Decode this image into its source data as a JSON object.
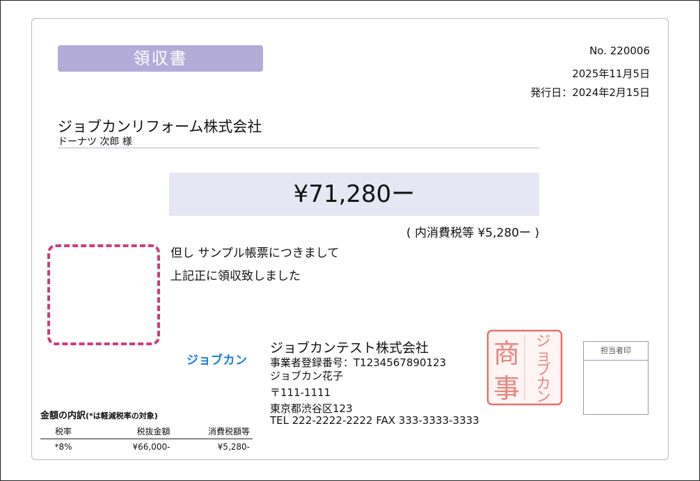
{
  "receipt": {
    "title": "領収書",
    "number": "No. 220006",
    "date": "2025年11月5日",
    "issue_date": "発行日：2024年2月15日"
  },
  "recipient": {
    "company": "ジョブカンリフォーム株式会社",
    "person": "ドーナツ 次郎 様"
  },
  "amount": {
    "total": "¥71,280ー",
    "tax_note": "( 内消費税等 ¥5,280ー )"
  },
  "memo": {
    "line1": "但し サンプル帳票につきまして",
    "line2": "上記正に領収致しました"
  },
  "issuer": {
    "logo_text": "ジョブカン",
    "company": "ジョブカンテスト株式会社",
    "registration": "事業者登録番号：T1234567890123",
    "person": "ジョブカン花子",
    "postal": "〒111-1111",
    "address": "東京都渋谷区123",
    "contact": "TEL 222-2222-2222 FAX 333-3333-3333"
  },
  "seal": {
    "left_text": "商事",
    "right_text": "ジョブカン",
    "color": "#e8706a"
  },
  "staff_stamp": {
    "label": "担当者印"
  },
  "breakdown": {
    "title": "金額の内訳",
    "title_note": "(*は軽減税率の対象)",
    "headers": [
      "税率",
      "税抜金額",
      "消費税額等"
    ],
    "rows": [
      [
        "*8%",
        "¥66,000-",
        "¥5,280-"
      ]
    ]
  },
  "colors": {
    "title_badge": "#b3acd8",
    "amount_box": "#e6e6f4",
    "dashed_border": "#d23a7a",
    "logo": "#1a7be0"
  }
}
